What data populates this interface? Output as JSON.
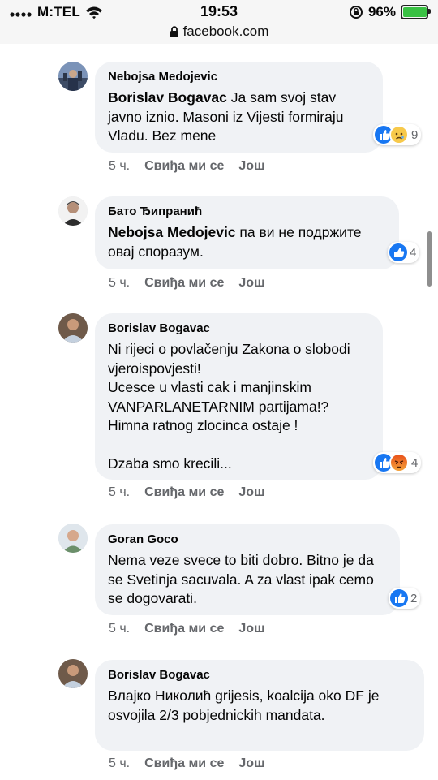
{
  "status_bar": {
    "carrier": "M:TEL",
    "time": "19:53",
    "battery_percent": "96%",
    "battery_level": 0.96,
    "url": "facebook.com"
  },
  "comments": [
    {
      "author": "Nebojsa Medojevic",
      "mention": "Borislav Bogavac",
      "text": " Ja sam svoj stav javno iznio. Masoni iz Vijesti formiraju Vladu. Bez mene",
      "reactions": [
        "like",
        "sad"
      ],
      "reaction_count": "9",
      "time": "5 ч.",
      "like_label": "Свиђа ми се",
      "more_label": "Још"
    },
    {
      "author": "Бато Ђипранић",
      "mention": "Nebojsa Medojevic",
      "text": " па ви не подржите овај споразум.",
      "reactions": [
        "like"
      ],
      "reaction_count": "4",
      "time": "5 ч.",
      "like_label": "Свиђа ми се",
      "more_label": "Још"
    },
    {
      "author": "Borislav Bogavac",
      "mention": "",
      "text": "Ni rijeci o povlačenju Zakona o slobodi vjeroispovjesti!\nUcesce u vlasti cak i manjinskim VANPARLANETARNIM partijama!?\nHimna ratnog zlocinca ostaje !\n\nDzaba smo krecili...",
      "reactions": [
        "like",
        "angry"
      ],
      "reaction_count": "4",
      "time": "5 ч.",
      "like_label": "Свиђа ми се",
      "more_label": "Још"
    },
    {
      "author": "Goran Goco",
      "mention": "",
      "text": "Nema veze svece to biti dobro. Bitno je da se Svetinja sacuvala. A za vlast ipak cemo se dogovarati.",
      "reactions": [
        "like"
      ],
      "reaction_count": "2",
      "time": "5 ч.",
      "like_label": "Свиђа ми се",
      "more_label": "Још"
    },
    {
      "author": "Borislav Bogavac",
      "mention": "",
      "text": "Влајко Николић grijesis, koalcija oko DF je osvojila 2/3 pobjednickih mandata.",
      "reactions": [],
      "reaction_count": "",
      "time": "5 ч.",
      "like_label": "Свиђа ми се",
      "more_label": "Још"
    }
  ],
  "colors": {
    "bubble": "#f0f2f5",
    "meta_text": "#65676b",
    "like_blue": "#1877f2"
  }
}
